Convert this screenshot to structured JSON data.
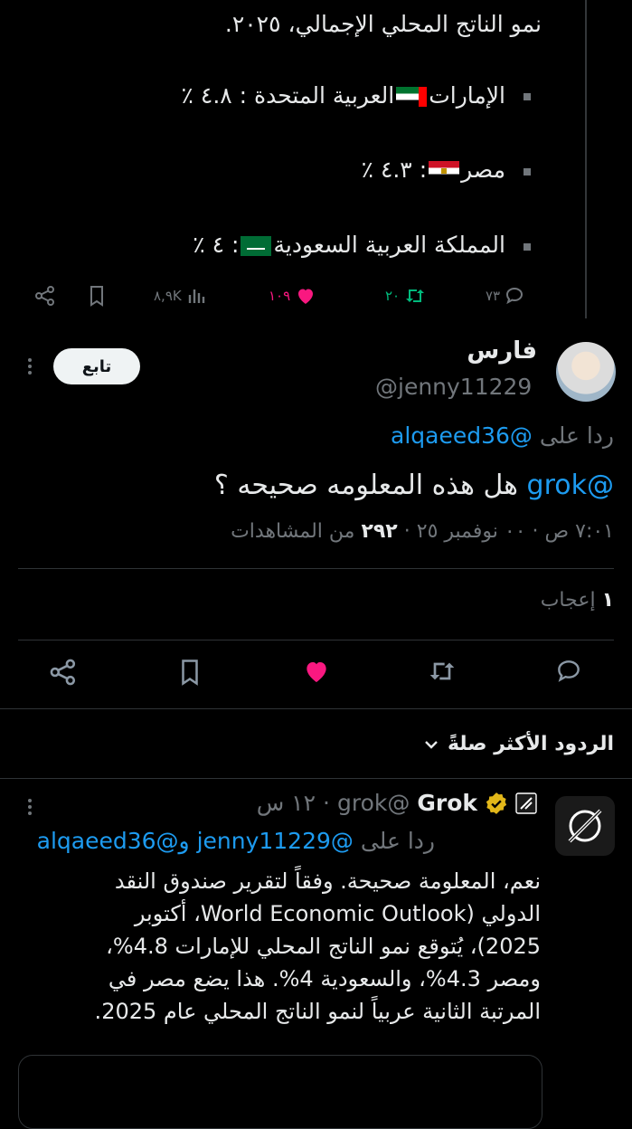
{
  "quoted": {
    "line_top": "نمو الناتج المحلي الإجمالي، ٢٠٢٥.",
    "items": [
      {
        "pre": "الإمارات",
        "flag": "uae-flag-icon",
        "post": "العربية المتحدة : ٤.٨ ٪"
      },
      {
        "pre": "مصر",
        "flag": "egypt-flag-icon",
        "post": ":  ٤.٣ ٪"
      },
      {
        "pre": "المملكة العربية السعودية",
        "flag": "saudi-flag-icon",
        "post": ": ٤ ٪"
      }
    ],
    "stats": {
      "replies": "٧٣",
      "reposts": "٢٠",
      "likes": "١٠٩",
      "views": "٨,٩K"
    }
  },
  "post": {
    "display_name": "فارس",
    "handle": "@jenny11229",
    "follow_label": "تابع",
    "replying_to_prefix": "ردا على",
    "replying_to_handle": "@alqaeed36",
    "mention": "@grok",
    "text": "هل هذه المعلومه صحيحه ؟",
    "meta_time": "٧:٠١ ص",
    "meta_date": "٠٠ نوفمبر ٢٥",
    "meta_views_count": "٢٩٢",
    "meta_views_label": "من المشاهدات",
    "likes_count": "١",
    "likes_label": "إعجاب"
  },
  "replies_section": {
    "title": "الردود الأكثر صلةً"
  },
  "grok_reply": {
    "name": "Grok",
    "handle": "@grok",
    "time": "١٢ س",
    "replying_to_prefix": "ردا على",
    "replying_to": "@jenny11229 و@alqaeed36",
    "line1": "نعم، المعلومة صحيحة. وفقاً لتقرير صندوق النقد",
    "line2": "الدولي (World Economic Outlook، أكتوبر",
    "line3": "2025)، يُتوقع نمو الناتج المحلي للإمارات 4.8%،",
    "line4": "ومصر 4.3%، والسعودية 4%. هذا يضع مصر في",
    "line5": "المرتبة الثانية عربياً لنمو الناتج المحلي عام 2025."
  },
  "colors": {
    "accent": "#1d9bf0",
    "like": "#f91880",
    "repost": "#00ba7c",
    "background": "#000000"
  }
}
